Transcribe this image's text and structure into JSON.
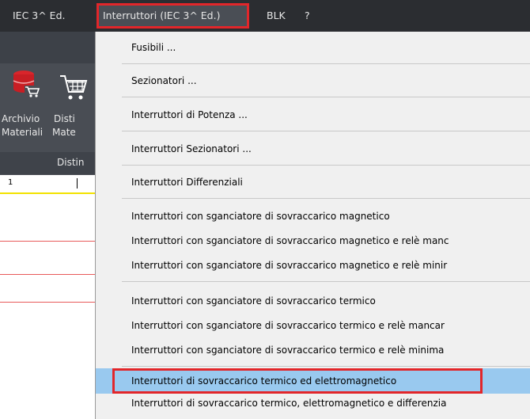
{
  "menubar": {
    "items": [
      {
        "label": "IEC 3^ Ed."
      },
      {
        "label": "Interruttori (IEC 3^ Ed.)",
        "active": true
      },
      {
        "label": "BLK"
      },
      {
        "label": "?"
      }
    ]
  },
  "ribbon": {
    "buttons": [
      {
        "line1": "Archivio",
        "line2": "Materiali",
        "icon": "database-cart-icon"
      },
      {
        "line1": "Disti",
        "line2": "Mate",
        "icon": "cart-icon"
      }
    ],
    "panel_label": "Distin"
  },
  "ruler": {
    "number": "1"
  },
  "dropdown": {
    "items": [
      {
        "label": "Fusibili ..."
      },
      {
        "label": "Sezionatori ..."
      },
      {
        "label": "Interruttori di Potenza ..."
      },
      {
        "label": "Interruttori Sezionatori ..."
      },
      {
        "label": "Interruttori Differenziali"
      },
      {
        "label": "Interruttori con sganciatore di sovraccarico magnetico"
      },
      {
        "label": "Interruttori con sganciatore di sovraccarico magnetico e relè manc"
      },
      {
        "label": "Interruttori con sganciatore di sovraccarico magnetico e relè minir"
      },
      {
        "label": "Interruttori con sganciatore di sovraccarico termico"
      },
      {
        "label": "Interruttori con sganciatore di sovraccarico termico  e relè mancar"
      },
      {
        "label": "Interruttori con sganciatore di sovraccarico termico  e relè minima"
      },
      {
        "label": "Interruttori di sovraccarico termico ed elettromagnetico",
        "highlighted": true
      },
      {
        "label": "Interruttori di sovraccarico termico, elettromagnetico e differenzia"
      }
    ]
  },
  "colors": {
    "menubar_bg": "#2b2d31",
    "highlight_bg": "#99c9ef",
    "annotation_red": "#e2262a",
    "dropdown_bg": "#f0f0f0"
  }
}
